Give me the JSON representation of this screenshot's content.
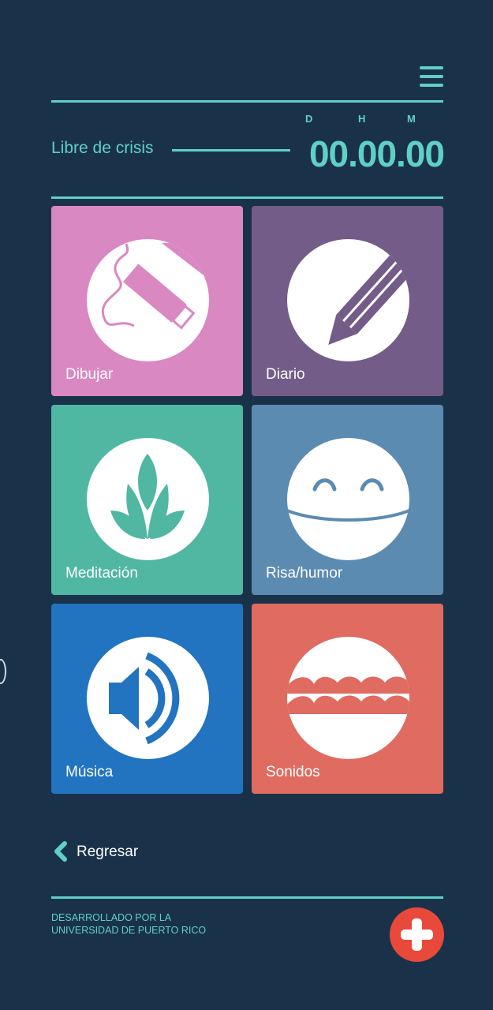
{
  "header": {
    "menu_icon": "hamburger-menu-icon",
    "accent_color": "#5fd0c6",
    "background_color": "#1a3249"
  },
  "timer": {
    "label": "Libre de crisis",
    "units": {
      "days": "D",
      "hours": "H",
      "minutes": "M"
    },
    "value": "00.00.00"
  },
  "tiles": [
    {
      "label": "Dibujar",
      "color": "#da88c2",
      "icon": "pen-tablet-icon"
    },
    {
      "label": "Diario",
      "color": "#735c87",
      "icon": "pencil-icon"
    },
    {
      "label": "Meditación",
      "color": "#4fb7a2",
      "icon": "lotus-icon"
    },
    {
      "label": "Risa/humor",
      "color": "#5c8bb1",
      "icon": "smiley-face-icon"
    },
    {
      "label": "Música",
      "color": "#2274c0",
      "icon": "speaker-icon"
    },
    {
      "label": "Sonidos",
      "color": "#e06b60",
      "icon": "waves-icon"
    }
  ],
  "nav": {
    "back_label": "Regresar",
    "back_icon": "chevron-left-icon"
  },
  "footer": {
    "line1": "DESARROLLADO POR LA",
    "line2": "UNIVERSIDAD DE PUERTO RICO",
    "fab_icon": "plus-icon",
    "fab_color": "#e8493b"
  }
}
